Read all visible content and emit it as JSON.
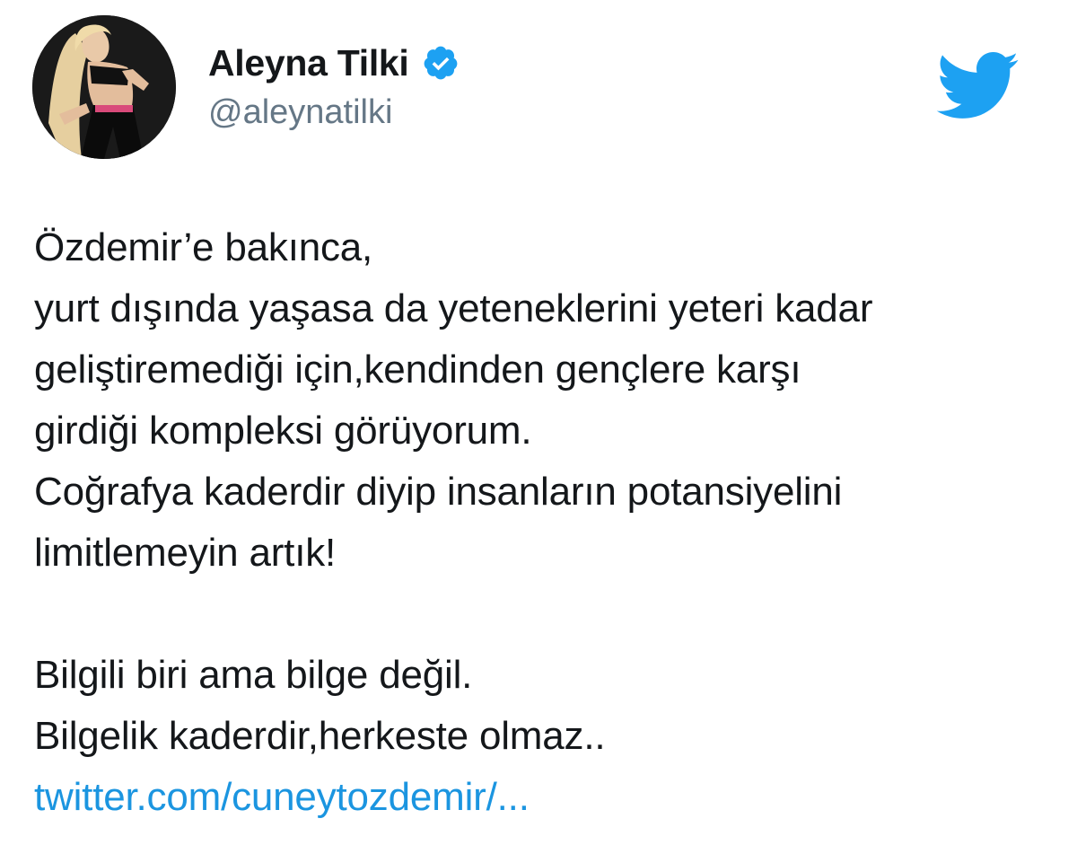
{
  "author": {
    "display_name": "Aleyna Tilki",
    "handle": "@aleynatilki",
    "verified": true,
    "avatar": "profile-photo"
  },
  "icons": {
    "verified": "verified-badge-icon",
    "platform_logo": "twitter-bird-icon"
  },
  "colors": {
    "link": "#1b95e0",
    "verified": "#1da1f2",
    "twitter_logo": "#1da1f2",
    "text": "#14171a",
    "secondary_text": "#657786"
  },
  "tweet": {
    "lines": [
      "Özdemir’e bakınca,",
      "yurt dışında yaşasa da yeteneklerini yeteri kadar",
      "geliştiremediği için,kendinden gençlere karşı",
      "girdiği kompleksi görüyorum.",
      "Coğrafya kaderdir diyip insanların potansiyelini",
      "limitlemeyin artık!",
      "",
      "Bilgili biri ama bilge değil.",
      "Bilgelik kaderdir,herkeste olmaz.."
    ],
    "link": "twitter.com/cuneytozdemir/..."
  }
}
